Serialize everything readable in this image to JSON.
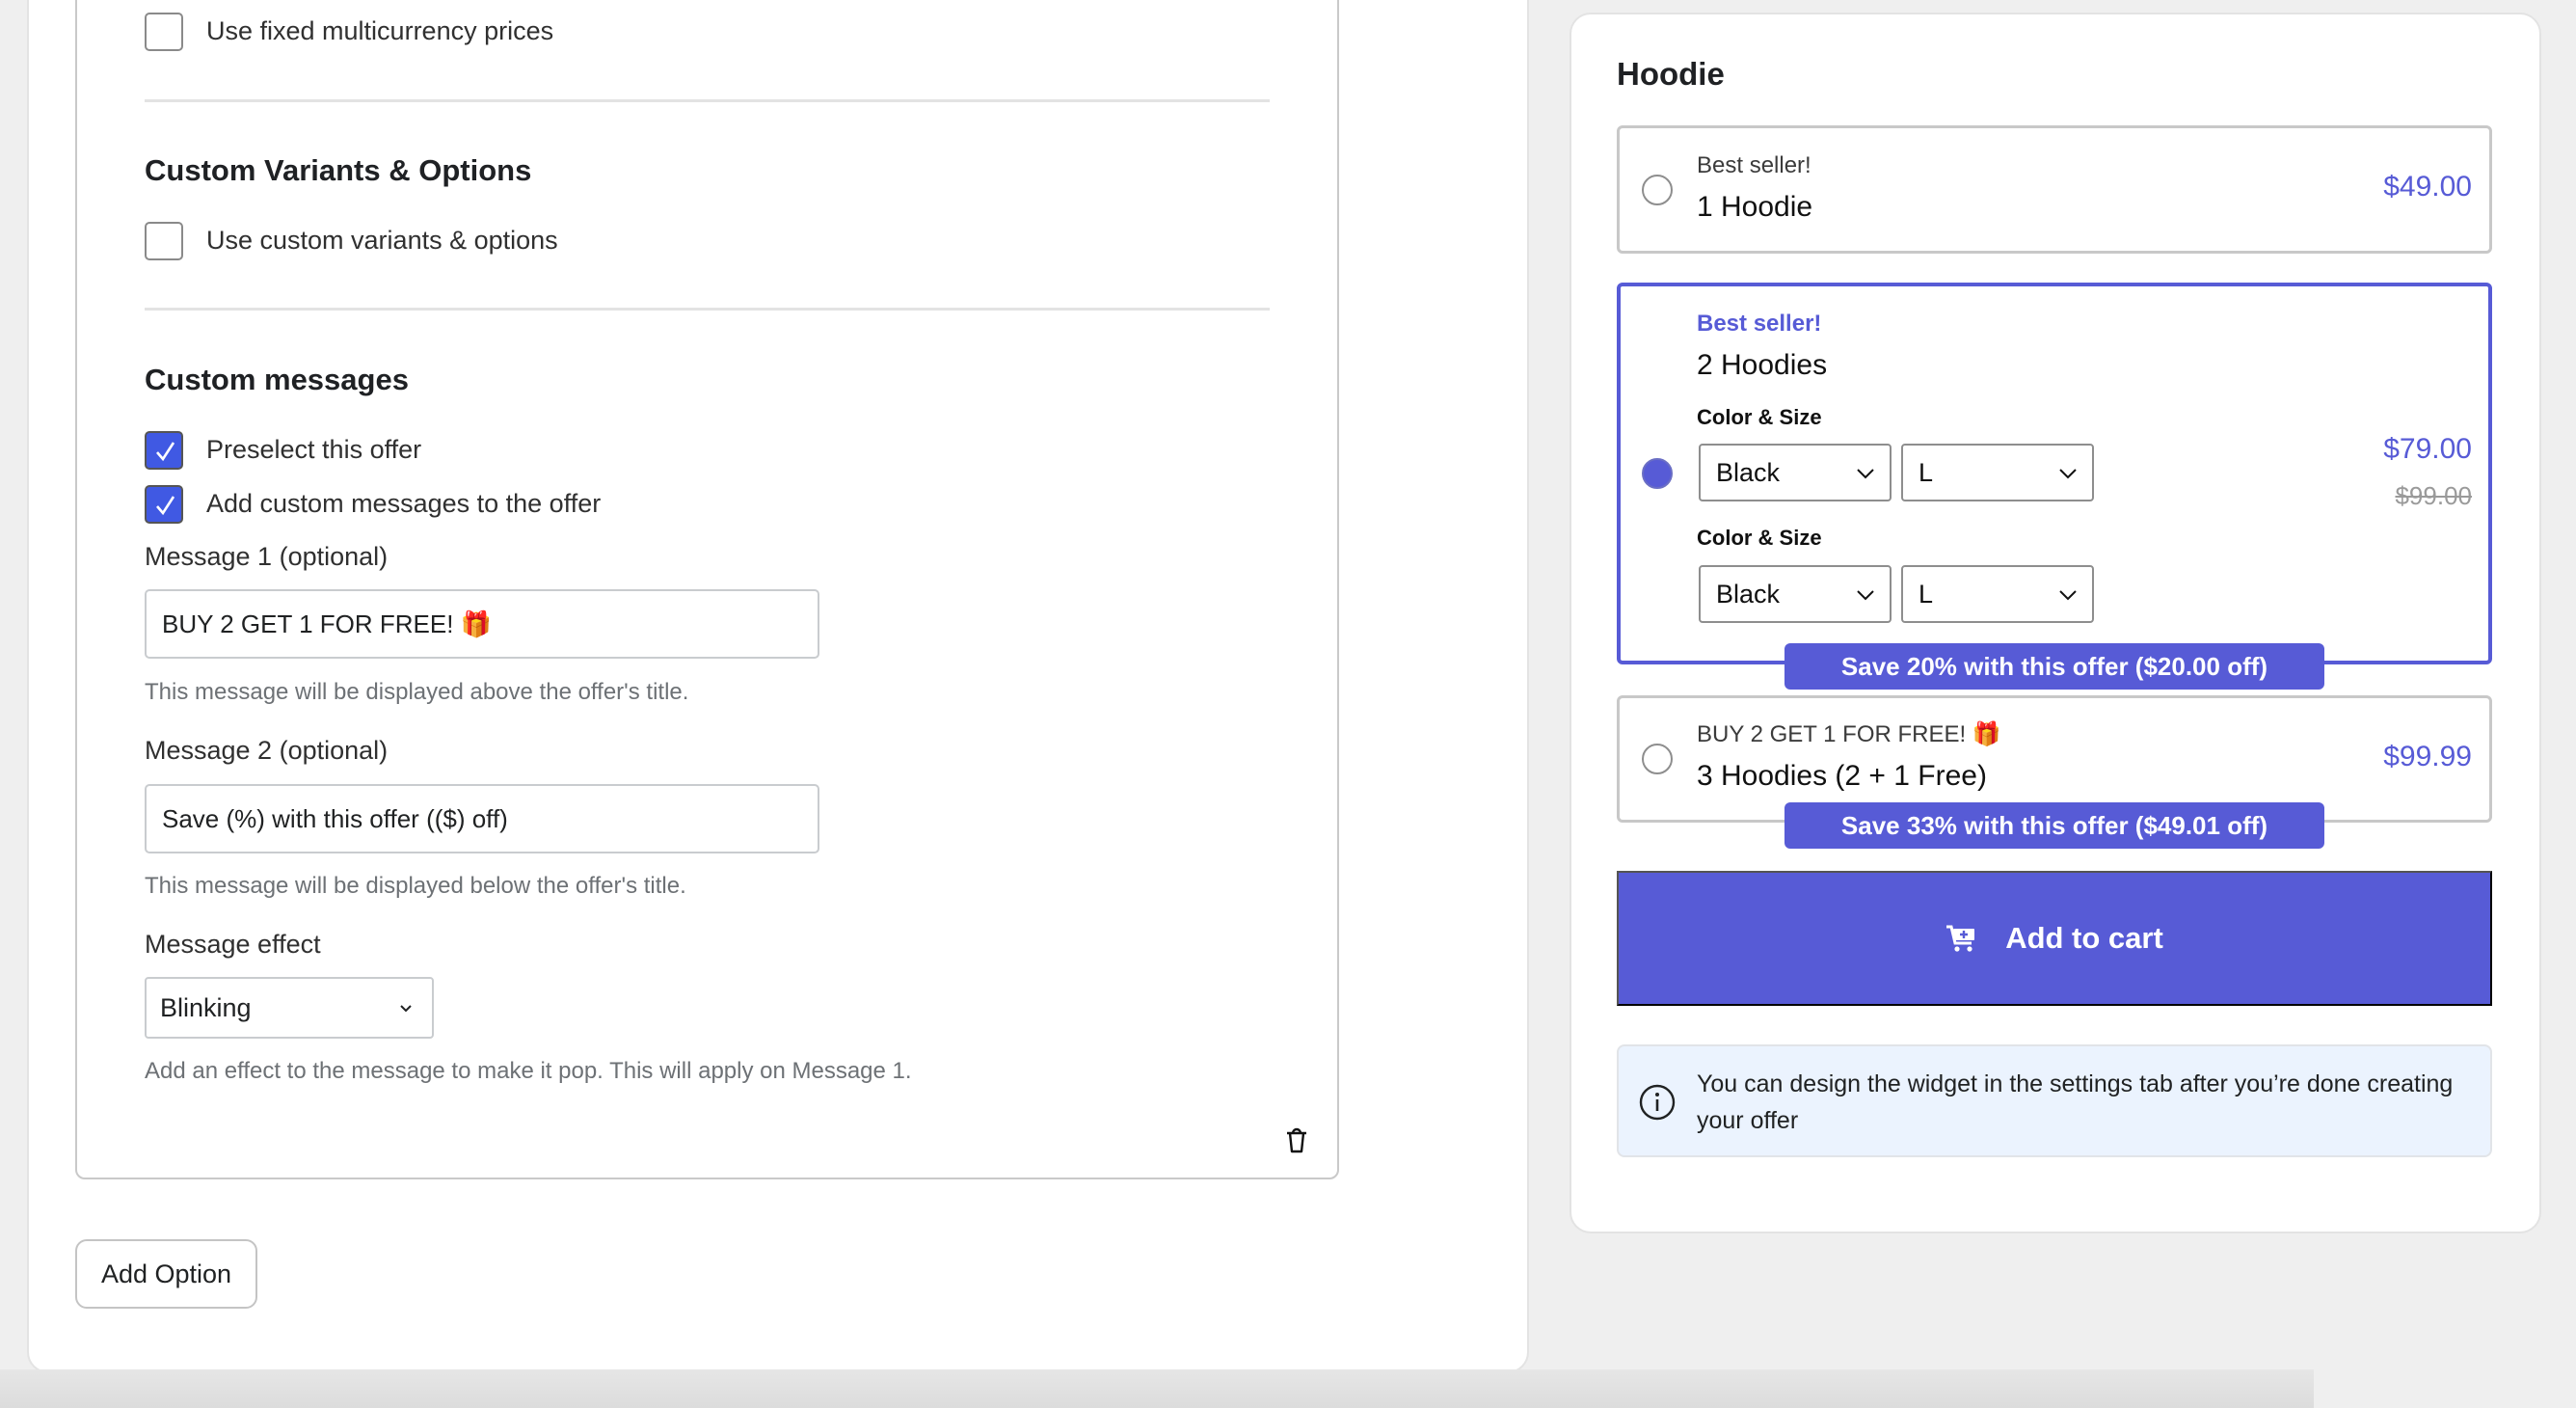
{
  "editor": {
    "multicurrency": {
      "label": "Use fixed multicurrency prices",
      "checked": false
    },
    "custom_variants": {
      "title": "Custom Variants & Options",
      "checkbox_label": "Use custom variants & options",
      "checked": false
    },
    "custom_messages": {
      "title": "Custom messages",
      "preselect": {
        "label": "Preselect this offer",
        "checked": true
      },
      "add_messages": {
        "label": "Add custom messages to the offer",
        "checked": true
      },
      "message1": {
        "label": "Message 1 (optional)",
        "value": "BUY 2 GET 1 FOR FREE! 🎁",
        "help": "This message will be displayed above the offer's title."
      },
      "message2": {
        "label": "Message 2 (optional)",
        "value": "Save (%) with this offer (($) off)",
        "help": "This message will be displayed below the offer's title."
      },
      "effect": {
        "label": "Message effect",
        "value": "Blinking",
        "help": "Add an effect to the message to make it pop. This will apply on Message 1."
      }
    },
    "delete_icon": "trash-icon",
    "add_option_label": "Add Option"
  },
  "preview": {
    "title": "Hoodie",
    "accent_color": "#575bd6",
    "offers": [
      {
        "message": "Best seller!",
        "title": "1 Hoodie",
        "price": "$49.00",
        "selected": false
      },
      {
        "message": "Best seller!",
        "title": "2 Hoodies",
        "price": "$79.00",
        "compare_price": "$99.00",
        "selected": true,
        "variants": [
          {
            "label": "Color & Size",
            "color": "Black",
            "size": "L"
          },
          {
            "label": "Color & Size",
            "color": "Black",
            "size": "L"
          }
        ],
        "badge": "Save 20% with this offer ($20.00 off)"
      },
      {
        "message": "BUY 2 GET 1 FOR FREE! 🎁",
        "title": "3 Hoodies (2 + 1 Free)",
        "price": "$99.99",
        "selected": false,
        "badge": "Save 33% with this offer ($49.01 off)"
      }
    ],
    "cart_button_label": "Add to cart",
    "cart_icon": "cart-plus-icon",
    "info_icon": "info-icon",
    "info_text": "You can design the widget in the settings tab after you’re done creating your offer"
  }
}
